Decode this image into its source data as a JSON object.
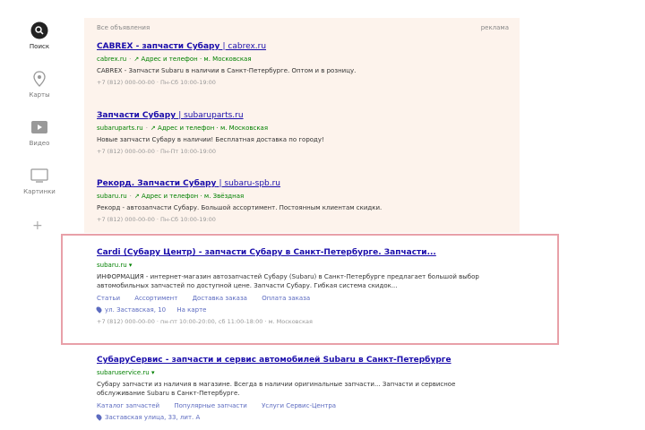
{
  "sidebar": {
    "items": [
      {
        "label": "Поиск",
        "icon": "search-icon",
        "active": true
      },
      {
        "label": "Карты",
        "icon": "map-pin-icon"
      },
      {
        "label": "Видео",
        "icon": "video-icon"
      },
      {
        "label": "Картинки",
        "icon": "image-icon"
      }
    ],
    "more": "+"
  },
  "ads": {
    "header": "Все объявления",
    "hint": "реклама",
    "items": [
      {
        "title": "СABREX - запчасти Субару",
        "domain": "| cabrex.ru",
        "url": "cabrex.ru",
        "extra": "Адрес и телефон · м. Московская",
        "snippet": "CABREX - Запчасти Subaru в наличии в Санкт-Петербурге. Оптом и в розницу.",
        "meta": "+7 (812) 000-00-00 · Пн-Сб 10:00-19:00"
      },
      {
        "title": "Запчасти Субару",
        "domain": "| subaruparts.ru",
        "url": "subaruparts.ru",
        "extra": "Адрес и телефон · м. Московская",
        "snippet": "Новые запчасти Субару в наличии! Бесплатная доставка по городу!",
        "meta": "+7 (812) 000-00-00 · Пн-Пт 10:00-19:00"
      },
      {
        "title": "Рекорд. Запчасти Субару",
        "domain": "| subaru-spb.ru",
        "url": "subaru.ru",
        "extra": "Адрес и телефон · м. Звёздная",
        "snippet": "Рекорд - автозапчасти Субару. Большой ассортимент. Постоянным клиентам скидки.",
        "meta": "+7 (812) 000-00-00 · Пн-Сб 10:00-19:00"
      }
    ]
  },
  "highlighted": {
    "title": "Cardi (Субару Центр) - запчасти Субару в Санкт-Петербурге. Запчасти...",
    "url": "subaru.ru",
    "snippet": "ИНФОРМАЦИЯ - интернет-магазин автозапчастей Субару (Subaru) в Санкт-Петербурге предлагает большой выбор автомобильных запчастей по доступной цене. Запчасти Субару. Гибкая система скидок...",
    "links": [
      "Статьи",
      "Ассортимент",
      "Доставка заказа",
      "Оплата заказа"
    ],
    "address": "ул. Заставская, 10",
    "address_link": "На карте",
    "meta": "+7 (812) 000-00-00 · пн-пт 10:00-20:00, сб 11:00-18:00 · м. Московская"
  },
  "organic": {
    "title": "СубаруСервис - запчасти и сервис автомобилей Subaru в Санкт-Петербурге",
    "url": "subaruservice.ru",
    "snippet": "Субару запчасти из наличия в магазине. Всегда в наличии оригинальные запчасти... Запчасти и сервисное обслуживание Subaru в Санкт-Петербурге.",
    "links": [
      "Каталог запчастей",
      "Популярные запчасти",
      "Услуги Сервис-Центра"
    ],
    "address": "Заставская улица, 33, лит. А"
  }
}
